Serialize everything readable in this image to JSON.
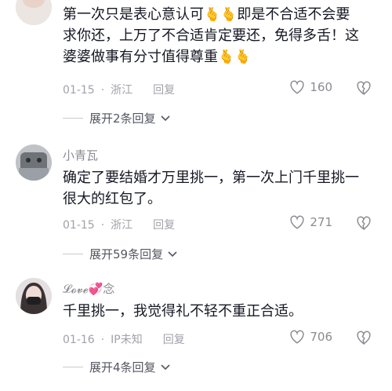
{
  "comments": [
    {
      "username": "",
      "text_lines": [
        "第一次只是表心意认可",
        "即是不合适不会要",
        "求你还，上万了不合适肯定要还，免得多舌！这",
        "婆婆做事有分寸值得尊重"
      ],
      "emoji_name": "finger-heart-icon",
      "date": "01-15",
      "location": "浙江",
      "reply_label": "回复",
      "likes": "160",
      "expand_label": "展开2条回复"
    },
    {
      "username": "小青瓦",
      "text_lines": [
        "确定了要结婚才万里挑一，第一次上门千里挑一",
        "很大的红包了。"
      ],
      "date": "01-15",
      "location": "浙江",
      "reply_label": "回复",
      "likes": "271",
      "expand_label": "展开59条回复"
    },
    {
      "username": "𝓛𝓸𝓿𝓮💞念",
      "text_lines": [
        "千里挑一，我觉得礼不轻不重正合适。"
      ],
      "date": "01-16",
      "location": "IP未知",
      "reply_label": "回复",
      "likes": "706",
      "expand_label": "展开4条回复"
    }
  ],
  "colors": {
    "text": "#161823",
    "meta": "#a1a2a8",
    "username": "#8a8b91"
  }
}
